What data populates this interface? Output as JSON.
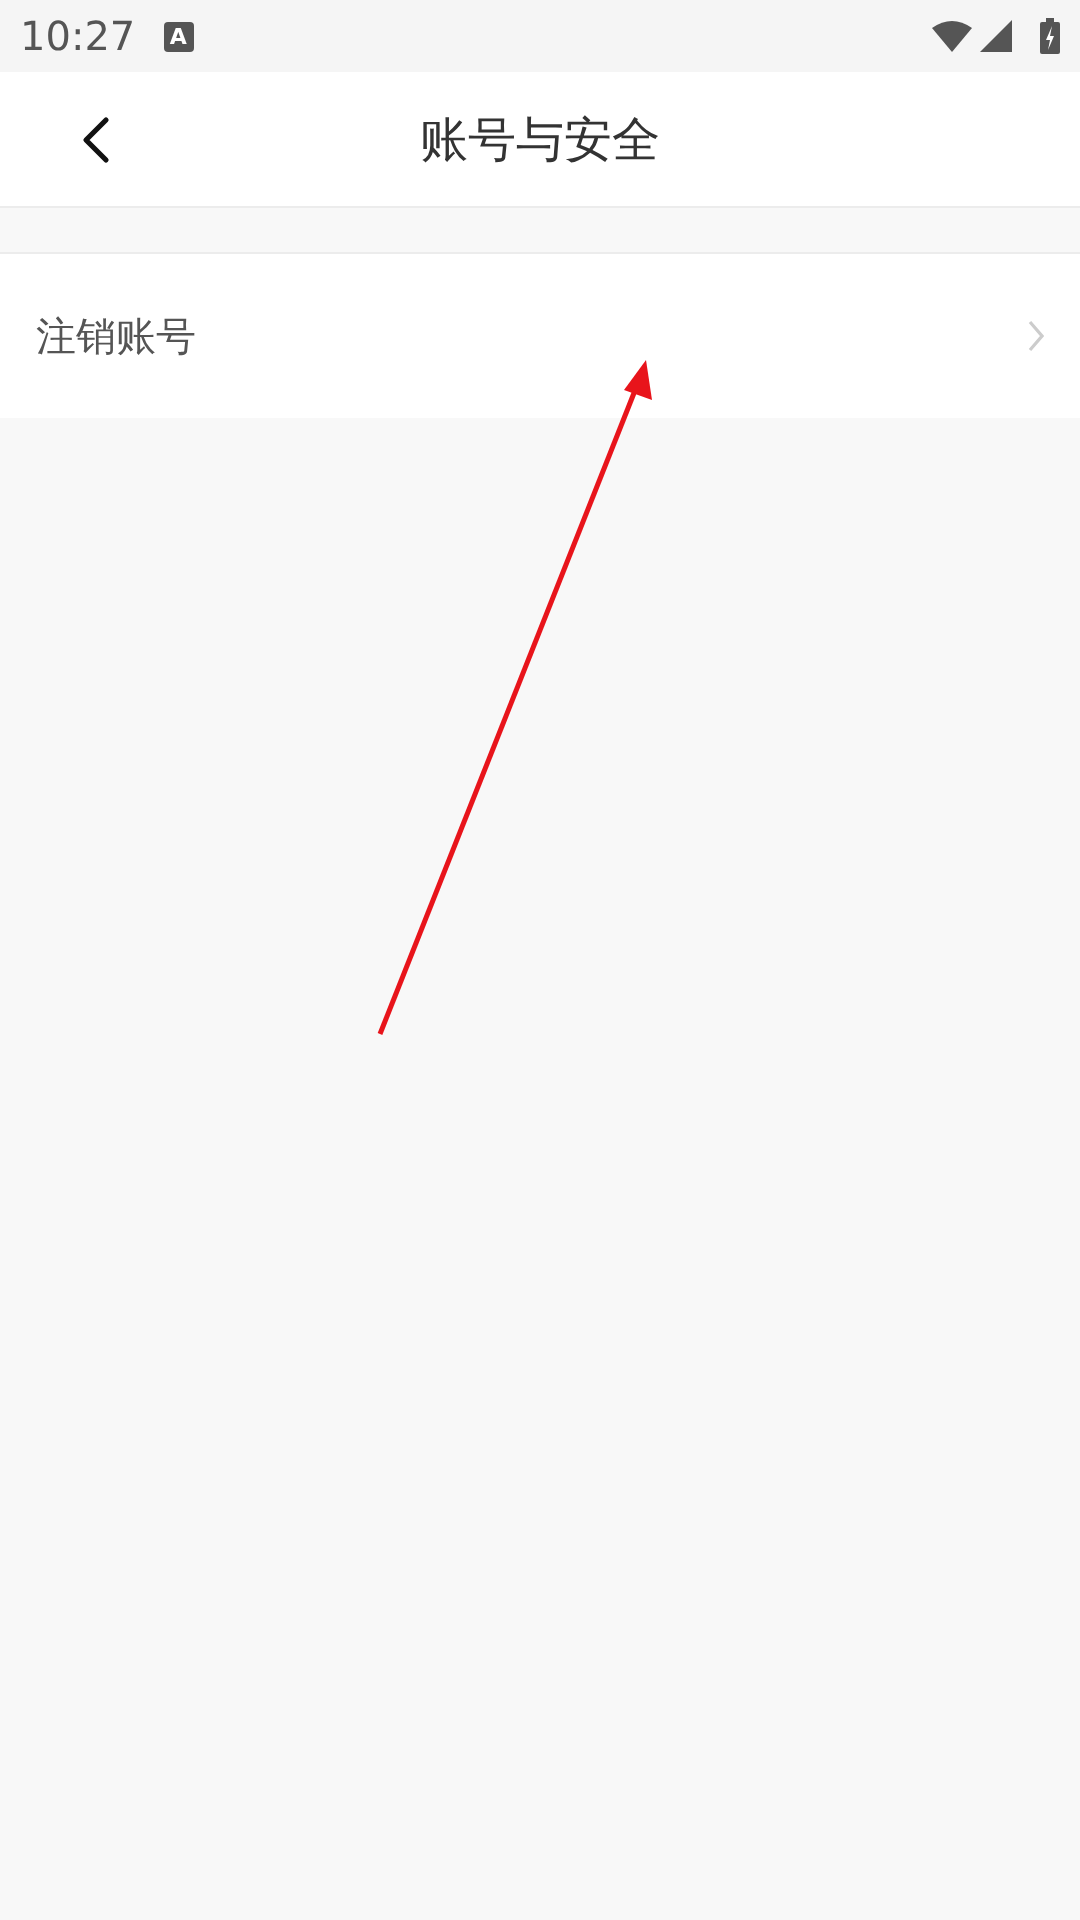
{
  "status_bar": {
    "time": "10:27",
    "notification": "A"
  },
  "header": {
    "title": "账号与安全"
  },
  "menu_items": [
    {
      "label": "注销账号"
    }
  ],
  "annotation": {
    "kind": "arrow",
    "color": "#e8141b"
  }
}
